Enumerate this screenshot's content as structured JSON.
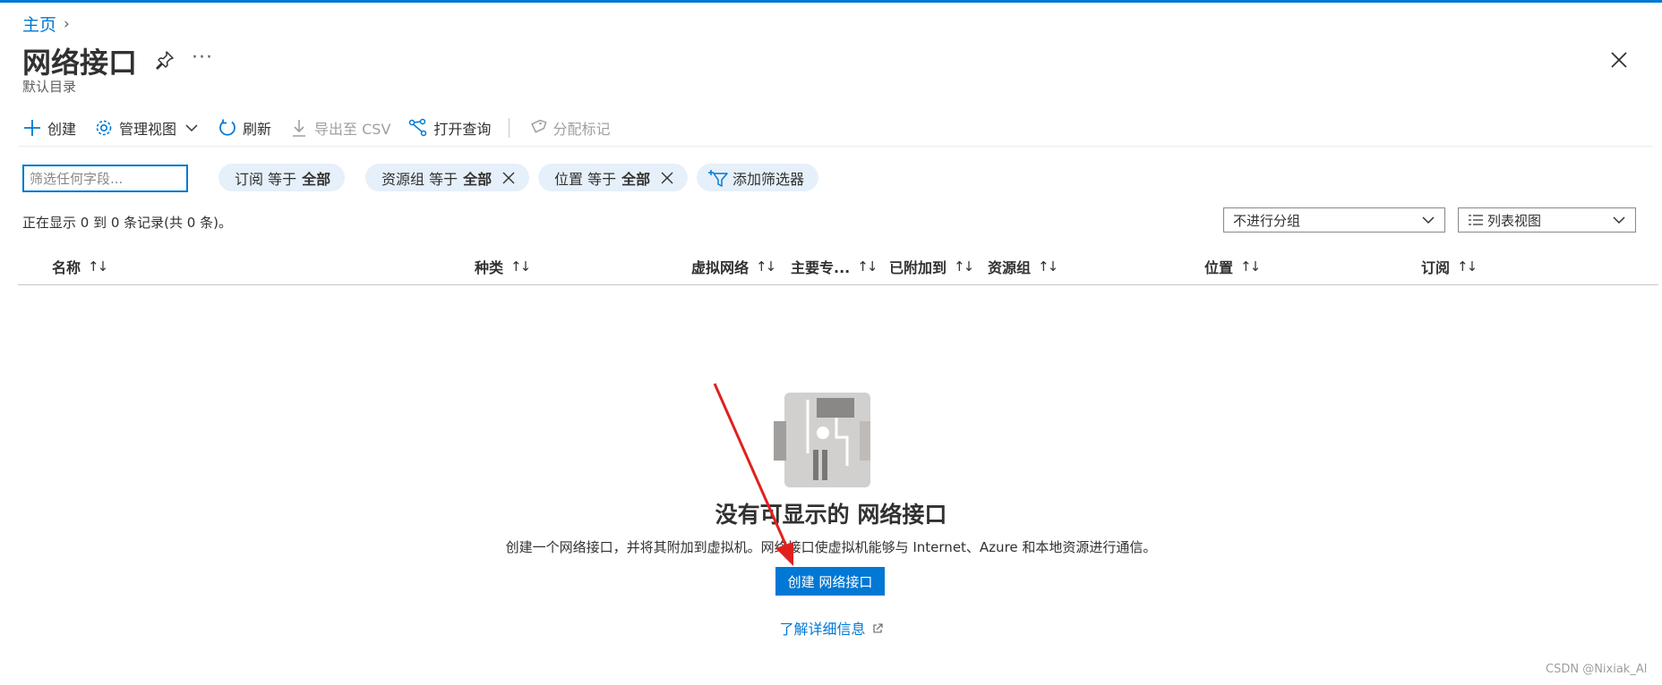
{
  "breadcrumb": {
    "home": "主页",
    "separator": "›"
  },
  "header": {
    "title": "网络接口",
    "subtitle": "默认目录",
    "more": "···"
  },
  "toolbar": {
    "create": "创建",
    "manage_view": "管理视图",
    "refresh": "刷新",
    "export_csv": "导出至 CSV",
    "open_query": "打开查询",
    "assign_tags": "分配标记"
  },
  "filters": {
    "search_placeholder": "筛选任何字段...",
    "subscription": {
      "label": "订阅 等于",
      "value": "全部"
    },
    "resource_group": {
      "label": "资源组 等于",
      "value": "全部"
    },
    "location": {
      "label": "位置 等于",
      "value": "全部"
    },
    "add_filter": "添加筛选器"
  },
  "status_text": "正在显示 0 到 0 条记录(共 0 条)。",
  "grouping": {
    "selected": "不进行分组"
  },
  "view_mode": {
    "selected": "列表视图"
  },
  "columns": [
    {
      "label": "名称",
      "sort": "↑↓"
    },
    {
      "label": "种类",
      "sort": "↑↓"
    },
    {
      "label": "虚拟网络",
      "sort": "↑↓"
    },
    {
      "label": "主要专...",
      "sort": "↑↓"
    },
    {
      "label": "已附加到",
      "sort": "↑↓"
    },
    {
      "label": "资源组",
      "sort": "↑↓"
    },
    {
      "label": "位置",
      "sort": "↑↓"
    },
    {
      "label": "订阅",
      "sort": "↑↓"
    }
  ],
  "empty_state": {
    "title": "没有可显示的 网络接口",
    "description": "创建一个网络接口，并将其附加到虚拟机。网络接口使虚拟机能够与 Internet、Azure 和本地资源进行通信。",
    "create_button": "创建 网络接口",
    "learn_more": "了解详细信息"
  },
  "watermark": "CSDN @Nixiak_Al",
  "colors": {
    "accent": "#0078d4",
    "pill_bg": "#e6f0fa",
    "annotation_arrow": "#e02020"
  }
}
